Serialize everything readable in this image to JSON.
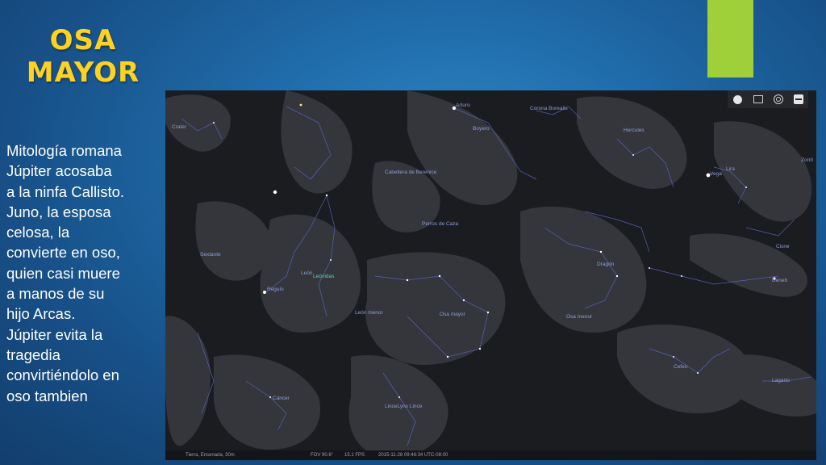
{
  "slide": {
    "title_line1": "OSA",
    "title_line2": "MAYOR",
    "body_lines": [
      "Mitología romana",
      "Júpiter acosaba",
      "a la ninfa Callisto.",
      "Juno, la esposa",
      "celosa, la",
      "convierte en oso,",
      "quien casi muere",
      "a manos de su",
      "hijo Arcas.",
      "Júpiter evita la",
      "tragedia",
      "convirtiéndolo en",
      "oso tambien"
    ],
    "accent_color": "#9fd03a",
    "title_color": "#ffd21f"
  },
  "sky_view": {
    "toolbar": [
      "moon-icon",
      "window-icon",
      "target-icon",
      "minus-icon"
    ],
    "constellations": {
      "crater": "Crater",
      "arturo": "Arturo",
      "corona": "Corona Borealis",
      "boyero": "Boyero",
      "hercules": "Hercules",
      "cabellera": "Cabellera de Berenice",
      "lira": "Lira",
      "vega": "Vega",
      "zorrillo": "Zorril",
      "perros": "Perros de Caza",
      "sextante": "Sextante",
      "leon": "León",
      "leonidas": "Leónidas",
      "regulo": "Regulo",
      "dragon": "Dragón",
      "cisne": "Cisne",
      "deneb": "Deneb",
      "leon_menor": "León menor",
      "osa_mayor": "Osa mayor",
      "osa_menor": "Osa menor",
      "cefeo": "Cefeo",
      "cancer": "Cáncer",
      "lagarto": "Lagarto",
      "lince": "LinceLynx   Lince"
    },
    "status": {
      "location": "Tierra, Ensenada, 30m",
      "fov": "FOV 90.6°",
      "fps": "15.1 FPS",
      "datetime": "2015-11-28    09:46:34 UTC-08:00"
    }
  }
}
